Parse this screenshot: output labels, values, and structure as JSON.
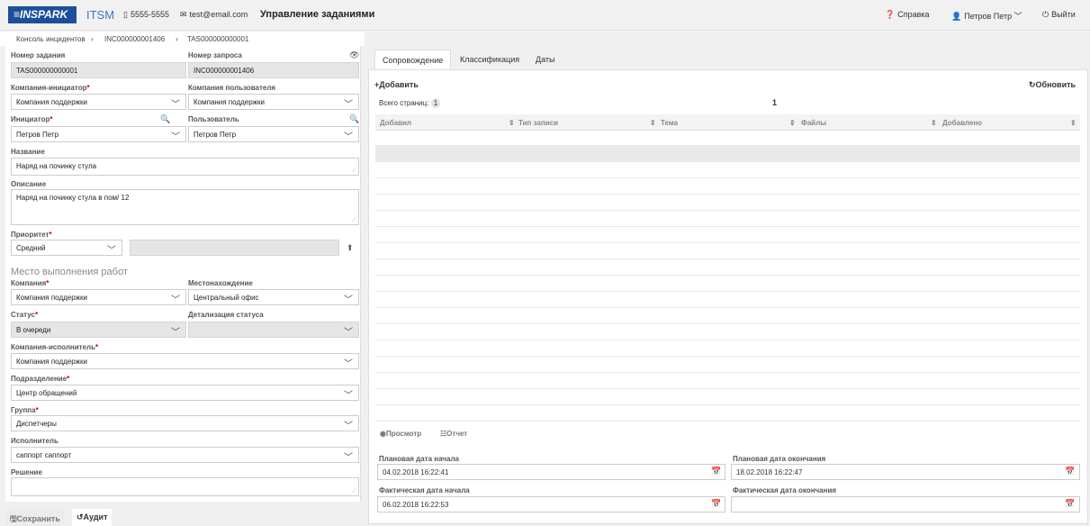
{
  "header": {
    "logo": "≡INSPARK",
    "logo_sub": "ITSM",
    "phone": "5555-5555",
    "email": "test@email.com",
    "title": "Управление заданиями",
    "help": "Справка",
    "user": "Петров Петр",
    "exit": "Выйти"
  },
  "breadcrumbs": [
    "Консоль инцидентов",
    "INC000000001406",
    "TAS000000000001"
  ],
  "form": {
    "task_number": {
      "label": "Номер задания",
      "value": "TAS000000000001"
    },
    "request_number": {
      "label": "Номер запроса",
      "value": "INC000000001406"
    },
    "company_initiator": {
      "label": "Компания-инициатор",
      "value": "Компания поддержки"
    },
    "company_user": {
      "label": "Компания пользователя",
      "value": "Компания поддержки"
    },
    "initiator": {
      "label": "Инициатор",
      "value": "Петров Петр"
    },
    "user": {
      "label": "Пользователь",
      "value": "Петров Петр"
    },
    "name": {
      "label": "Название",
      "value": "Наряд на починку стула"
    },
    "description": {
      "label": "Описание",
      "value": "Наряд на починку стула в пом/ 12"
    },
    "priority": {
      "label": "Приоритет",
      "value": "Средний"
    },
    "section_title": "Место выполнения работ",
    "company": {
      "label": "Компания",
      "value": "Компания поддержки"
    },
    "location": {
      "label": "Местонахождение",
      "value": "Центральный офис"
    },
    "status": {
      "label": "Статус",
      "value": "В очереди"
    },
    "status_detail": {
      "label": "Детализация статуса",
      "value": ""
    },
    "company_executor": {
      "label": "Компания-исполнитель",
      "value": "Компания поддержки"
    },
    "department": {
      "label": "Подразделение",
      "value": "Центр обращений"
    },
    "group": {
      "label": "Группа",
      "value": "Диспетчеры"
    },
    "executor": {
      "label": "Исполнитель",
      "value": "саппорт саппорт"
    },
    "solution": {
      "label": "Решение",
      "value": ""
    }
  },
  "footer_buttons": {
    "save": "Сохранить",
    "audit": "Аудит"
  },
  "tabs": [
    "Сопровождение",
    "Классификация",
    "Даты"
  ],
  "grid": {
    "add": "Добавить",
    "refresh": "Обновить",
    "total_pages_label": "Всего страниц:",
    "total_pages": "1",
    "page": "1",
    "columns": [
      "Добавил",
      "Тип записи",
      "Тема",
      "Файлы",
      "Добавлено"
    ]
  },
  "actions": {
    "view": "Просмотр",
    "report": "Отчет"
  },
  "dates": {
    "plan_start": {
      "label": "Плановая дата начала",
      "value": "04.02.2018 16:22:41"
    },
    "plan_end": {
      "label": "Плановая дата окончания",
      "value": "18.02.2018 16:22:47"
    },
    "fact_start": {
      "label": "Фактическая дата начала",
      "value": "06.02.2018 16:22:53"
    },
    "fact_end": {
      "label": "Фактическая дата окончания",
      "value": ""
    }
  },
  "icons": [
    "phone-icon",
    "mail-icon",
    "help-icon",
    "user-icon",
    "power-icon",
    "eye-icon",
    "search-icon",
    "chevron-down-icon",
    "upload-icon",
    "plus-icon",
    "refresh-icon",
    "sort-icon",
    "calendar-icon",
    "save-icon",
    "audit-icon",
    "report-icon"
  ],
  "colors": {
    "brand": "#1b4f99",
    "accent": "#3a77c9",
    "required": "#cc0000"
  }
}
